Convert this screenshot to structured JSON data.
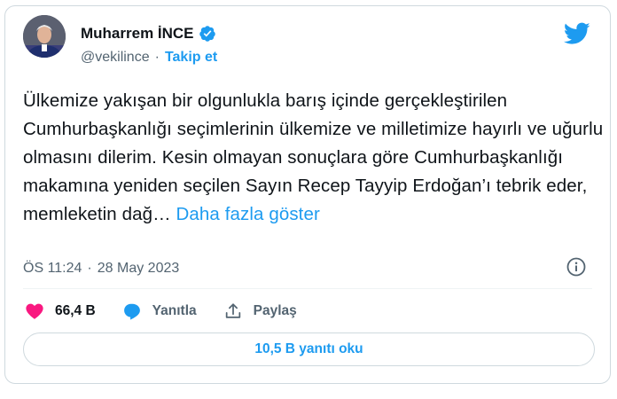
{
  "author": {
    "name": "Muharrem İNCE",
    "handle": "@vekilince",
    "separator": "·",
    "follow_label": "Takip et"
  },
  "tweet": {
    "text": "Ülkemize yakışan bir olgunlukla barış içinde gerçekleştirilen Cumhurbaşkanlığı seçimlerinin ülkemize ve milletimize hayırlı ve uğurlu olmasını dilerim. Kesin olmayan sonuçlara göre Cumhurbaşkanlığı makamına yeniden seçilen Sayın Recep Tayyip Erdoğan’ı tebrik eder, memleketin dağ…",
    "show_more": "Daha fazla göster",
    "time": "ÖS 11:24",
    "date_separator": "·",
    "date": "28 May 2023"
  },
  "actions": {
    "likes": "66,4 B",
    "reply_label": "Yanıtla",
    "share_label": "Paylaş"
  },
  "replies_button": "10,5 B yanıtı oku",
  "colors": {
    "accent": "#1d9bf0",
    "like": "#f91880",
    "muted": "#536471"
  },
  "icons": [
    "verified-badge-icon",
    "twitter-bird-icon",
    "info-icon",
    "heart-icon",
    "reply-bubble-icon",
    "share-icon"
  ]
}
